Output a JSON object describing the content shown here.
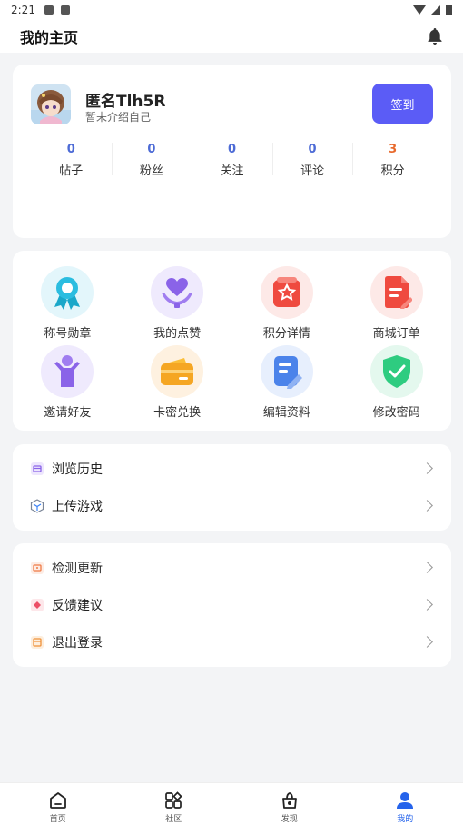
{
  "status_bar": {
    "time": "2:21"
  },
  "header": {
    "title": "我的主页",
    "bell_icon": "bell-icon"
  },
  "profile": {
    "username": "匿名Tlh5R",
    "bio": "暂未介绍自己",
    "signin_label": "签到",
    "stats": [
      {
        "value": "0",
        "label": "帖子"
      },
      {
        "value": "0",
        "label": "粉丝"
      },
      {
        "value": "0",
        "label": "关注"
      },
      {
        "value": "0",
        "label": "评论"
      },
      {
        "value": "3",
        "label": "积分"
      }
    ]
  },
  "features": [
    {
      "label": "称号勋章",
      "icon": "medal-icon"
    },
    {
      "label": "我的点赞",
      "icon": "heart-hands-icon"
    },
    {
      "label": "积分详情",
      "icon": "points-card-icon"
    },
    {
      "label": "商城订单",
      "icon": "order-document-icon"
    },
    {
      "label": "邀请好友",
      "icon": "invite-person-icon"
    },
    {
      "label": "卡密兑换",
      "icon": "wallet-card-icon"
    },
    {
      "label": "编辑资料",
      "icon": "edit-document-icon"
    },
    {
      "label": "修改密码",
      "icon": "shield-check-icon"
    }
  ],
  "list1": [
    {
      "label": "浏览历史",
      "icon": "history-icon"
    },
    {
      "label": "上传游戏",
      "icon": "upload-game-icon"
    }
  ],
  "list2": [
    {
      "label": "检测更新",
      "icon": "update-icon"
    },
    {
      "label": "反馈建议",
      "icon": "feedback-icon"
    },
    {
      "label": "退出登录",
      "icon": "logout-icon"
    }
  ],
  "nav": [
    {
      "label": "首页",
      "icon": "home-icon"
    },
    {
      "label": "社区",
      "icon": "community-grid-icon"
    },
    {
      "label": "发现",
      "icon": "discover-icon"
    },
    {
      "label": "我的",
      "icon": "user-icon"
    }
  ],
  "colors": {
    "accent": "#5b5cf6",
    "nav_active": "#2563eb",
    "points_orange": "#e86a2d",
    "stat_blue": "#4d6bd6"
  }
}
